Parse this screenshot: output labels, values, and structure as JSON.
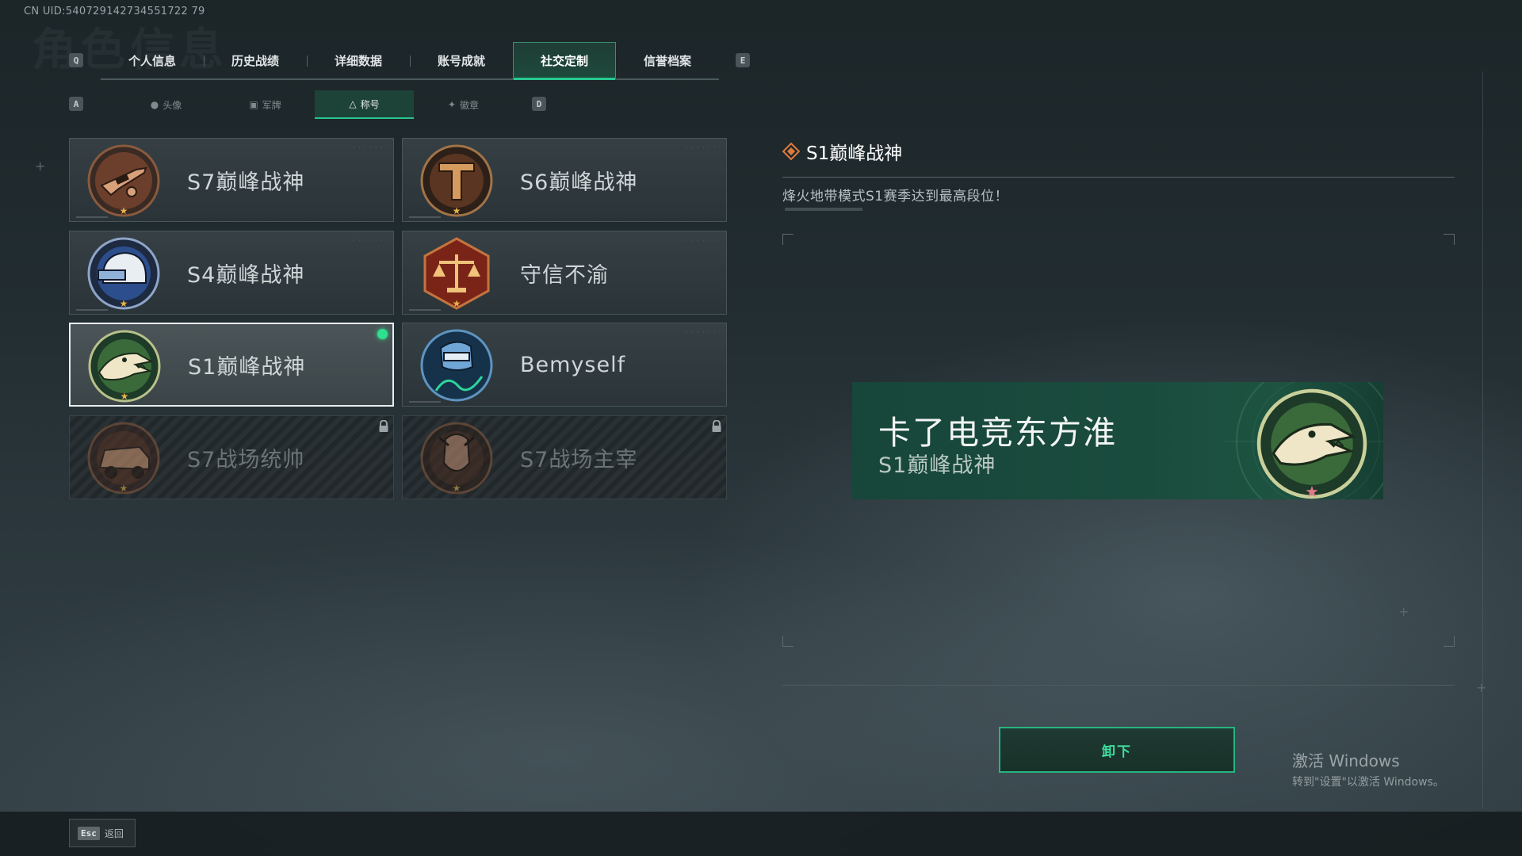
{
  "meta": {
    "uid": "CN UID:540729142734551722 79"
  },
  "header": {
    "watermark": "角色信息",
    "prev_key": "Q",
    "next_key": "E",
    "tabs": [
      {
        "label": "个人信息"
      },
      {
        "label": "历史战绩"
      },
      {
        "label": "详细数据"
      },
      {
        "label": "账号成就"
      },
      {
        "label": "社交定制",
        "active": true
      },
      {
        "label": "信誉档案"
      }
    ]
  },
  "subnav": {
    "prev_key": "A",
    "next_key": "D",
    "tabs": [
      {
        "label": "头像",
        "icon": "person-icon"
      },
      {
        "label": "军牌",
        "icon": "dogtag-icon"
      },
      {
        "label": "称号",
        "icon": "title-icon",
        "active": true
      },
      {
        "label": "徽章",
        "icon": "badge-icon"
      }
    ]
  },
  "titles": [
    {
      "name": "S7巅峰战神",
      "emblem": "rifle-emblem",
      "state": "available"
    },
    {
      "name": "S6巅峰战神",
      "emblem": "t-shield-emblem",
      "state": "available"
    },
    {
      "name": "S4巅峰战神",
      "emblem": "helmet-emblem",
      "state": "available"
    },
    {
      "name": "守信不渝",
      "emblem": "scales-emblem",
      "state": "available"
    },
    {
      "name": "S1巅峰战神",
      "emblem": "crocodile-emblem",
      "state": "selected-equipped"
    },
    {
      "name": "Bemyself",
      "emblem": "soldier-signature-emblem",
      "state": "available"
    },
    {
      "name": "S7战场统帅",
      "emblem": "armored-vehicle-emblem",
      "state": "locked"
    },
    {
      "name": "S7战场主宰",
      "emblem": "warrior-portrait-emblem",
      "state": "locked"
    }
  ],
  "detail": {
    "title": "S1巅峰战神",
    "description": "烽火地带模式S1赛季达到最高段位！",
    "preview": {
      "player_name": "卡了电竞东方淮",
      "title": "S1巅峰战神"
    },
    "unequip_label": "卸下"
  },
  "footer": {
    "back_key": "Esc",
    "back_label": "返回"
  },
  "os_overlay": {
    "activate_title": "激活 Windows",
    "activate_sub": "转到\"设置\"以激活 Windows。"
  },
  "colors": {
    "accent": "#27c48c",
    "equipped_dot": "#2ee08d",
    "preview_bg": "#1a4c3e"
  }
}
